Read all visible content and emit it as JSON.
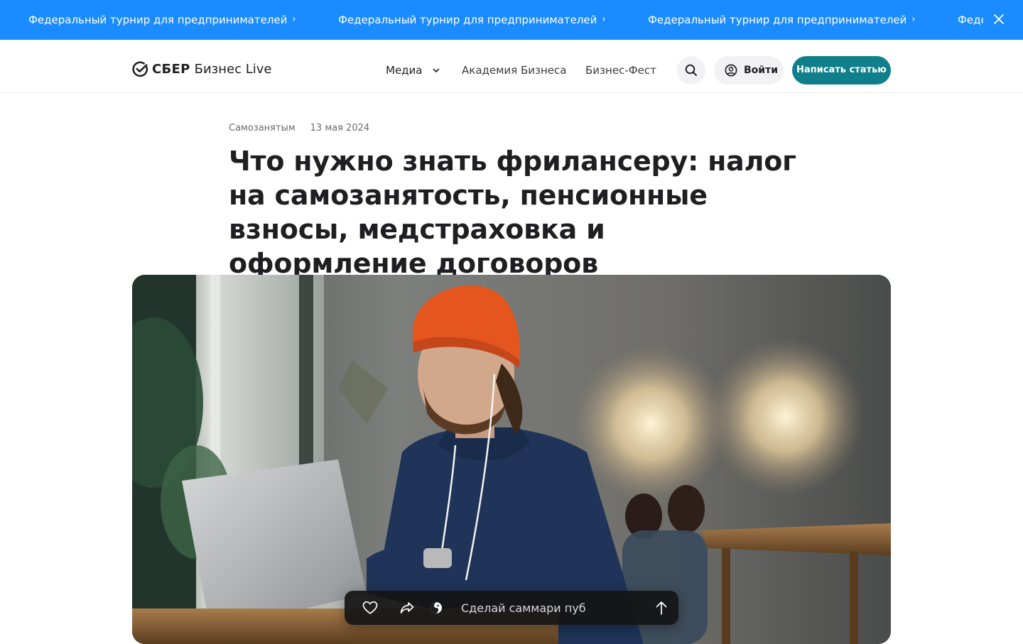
{
  "promo": {
    "items": [
      "Федеральный турнир для предпринимателей",
      "Федеральный турнир для предпринимателей",
      "Федеральный турнир для предпринимателей",
      "Федера"
    ],
    "close_icon": "close-icon"
  },
  "header": {
    "logo_brand": "СБЕР",
    "logo_sub": "Бизнес Live",
    "nav": {
      "media": "Медиа",
      "academy": "Академия Бизнеса",
      "fest": "Бизнес-Фест"
    },
    "login_label": "Войти",
    "write_label": "Написать статью"
  },
  "article": {
    "category": "Самозанятым",
    "date": "13 мая 2024",
    "title": "Что нужно знать фрилансеру: налог на самозанятость, пенсионные взносы, медстраховка и оформление договоров"
  },
  "action_bar": {
    "summary_value": "Сделай саммари пуб",
    "icons": [
      "heart-icon",
      "share-icon",
      "gigachat-icon",
      "arrow-up-icon"
    ]
  },
  "colors": {
    "promo_bg": "#1a8cff",
    "accent": "#107f8c",
    "text": "#1f1f22"
  }
}
